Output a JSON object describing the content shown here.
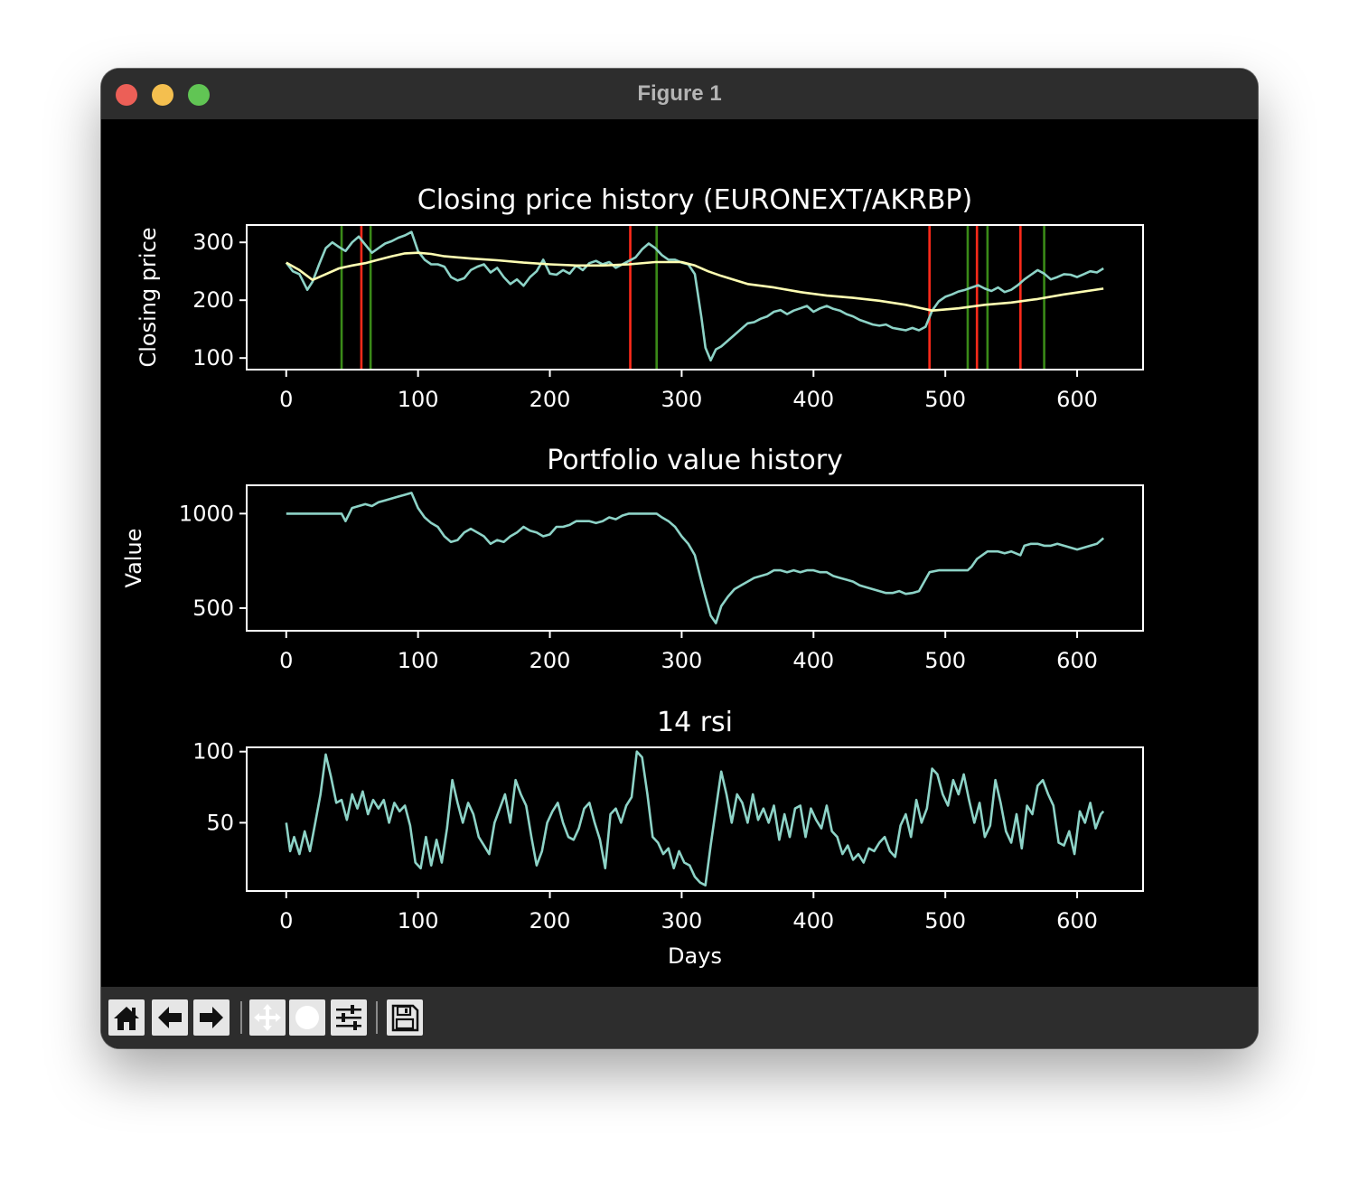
{
  "window": {
    "title": "Figure 1"
  },
  "toolbar": {
    "buttons": [
      {
        "name": "home",
        "icon": "home-icon"
      },
      {
        "name": "back",
        "icon": "arrow-left-icon"
      },
      {
        "name": "forward",
        "icon": "arrow-right-icon"
      },
      {
        "name": "pan",
        "icon": "move-icon"
      },
      {
        "name": "zoom",
        "icon": "zoom-icon"
      },
      {
        "name": "configure",
        "icon": "sliders-icon"
      },
      {
        "name": "save",
        "icon": "save-icon"
      }
    ]
  },
  "colors": {
    "figure_bg": "#000000",
    "axes_edge": "#ffffff",
    "text": "#ffffff",
    "series_main": "#8dd3c7",
    "series_ma": "#ffffb3",
    "buy_line": "#3a8a18",
    "sell_line": "#ff2a1a"
  },
  "chart_data": [
    {
      "type": "line",
      "title": "Closing price history (EURONEXT/AKRBP)",
      "xlabel": "",
      "ylabel": "Closing price",
      "xlim": [
        -30,
        650
      ],
      "ylim": [
        80,
        330
      ],
      "xticks": [
        0,
        100,
        200,
        300,
        400,
        500,
        600
      ],
      "yticks": [
        100,
        200,
        300
      ],
      "series": [
        {
          "role": "price",
          "color": "#8dd3c7",
          "x": [
            0,
            5,
            10,
            16,
            20,
            25,
            30,
            35,
            40,
            45,
            50,
            55,
            60,
            65,
            70,
            75,
            80,
            85,
            90,
            95,
            100,
            105,
            110,
            115,
            120,
            125,
            130,
            135,
            140,
            145,
            150,
            155,
            160,
            165,
            170,
            175,
            180,
            185,
            190,
            195,
            200,
            205,
            210,
            215,
            220,
            225,
            230,
            235,
            240,
            245,
            250,
            255,
            260,
            265,
            270,
            275,
            280,
            285,
            290,
            295,
            300,
            305,
            310,
            315,
            318,
            322,
            326,
            330,
            335,
            340,
            345,
            350,
            355,
            360,
            365,
            370,
            375,
            380,
            385,
            390,
            395,
            400,
            405,
            410,
            415,
            420,
            425,
            430,
            435,
            440,
            445,
            450,
            455,
            460,
            465,
            470,
            475,
            480,
            485,
            490,
            495,
            500,
            505,
            510,
            515,
            520,
            525,
            530,
            535,
            540,
            545,
            550,
            555,
            560,
            565,
            570,
            575,
            580,
            585,
            590,
            595,
            600,
            605,
            610,
            615,
            620
          ],
          "y": [
            265,
            250,
            245,
            218,
            232,
            262,
            290,
            300,
            292,
            285,
            300,
            310,
            296,
            282,
            290,
            298,
            302,
            308,
            312,
            318,
            285,
            270,
            262,
            262,
            258,
            240,
            234,
            238,
            252,
            258,
            262,
            248,
            256,
            240,
            228,
            236,
            225,
            240,
            250,
            270,
            246,
            244,
            252,
            246,
            260,
            252,
            264,
            268,
            262,
            266,
            256,
            262,
            268,
            274,
            288,
            298,
            290,
            278,
            270,
            270,
            265,
            262,
            245,
            170,
            118,
            96,
            115,
            120,
            130,
            140,
            150,
            160,
            162,
            168,
            172,
            180,
            183,
            176,
            182,
            186,
            190,
            180,
            186,
            190,
            185,
            182,
            176,
            172,
            166,
            162,
            158,
            156,
            158,
            152,
            150,
            148,
            152,
            148,
            154,
            182,
            198,
            206,
            210,
            215,
            218,
            222,
            226,
            220,
            216,
            222,
            214,
            218,
            226,
            236,
            244,
            252,
            246,
            236,
            240,
            245,
            244,
            240,
            245,
            250,
            248,
            255
          ]
        },
        {
          "role": "moving-average",
          "color": "#ffffb3",
          "x": [
            0,
            10,
            20,
            30,
            40,
            50,
            60,
            70,
            80,
            90,
            100,
            110,
            120,
            140,
            160,
            180,
            200,
            220,
            240,
            260,
            280,
            300,
            310,
            320,
            330,
            340,
            350,
            370,
            390,
            410,
            430,
            450,
            470,
            490,
            510,
            530,
            550,
            570,
            590,
            620
          ],
          "y": [
            265,
            252,
            235,
            245,
            255,
            260,
            264,
            270,
            276,
            281,
            282,
            280,
            276,
            272,
            269,
            265,
            262,
            260,
            260,
            262,
            266,
            266,
            260,
            250,
            242,
            235,
            228,
            222,
            214,
            208,
            204,
            199,
            192,
            182,
            186,
            192,
            196,
            202,
            210,
            220
          ]
        }
      ],
      "vlines": {
        "buy": {
          "color": "#3a8a18",
          "x": [
            42,
            64,
            281,
            517,
            532,
            575
          ]
        },
        "sell": {
          "color": "#ff2a1a",
          "x": [
            57,
            261,
            488,
            524,
            557
          ]
        }
      }
    },
    {
      "type": "line",
      "title": "Portfolio value history",
      "xlabel": "",
      "ylabel": "Value",
      "xlim": [
        -30,
        650
      ],
      "ylim": [
        380,
        1150
      ],
      "xticks": [
        0,
        100,
        200,
        300,
        400,
        500,
        600
      ],
      "yticks": [
        500,
        1000
      ],
      "series": [
        {
          "role": "portfolio",
          "color": "#8dd3c7",
          "x": [
            0,
            42,
            45,
            50,
            55,
            60,
            65,
            70,
            75,
            80,
            85,
            90,
            95,
            100,
            105,
            110,
            115,
            120,
            125,
            130,
            135,
            140,
            145,
            150,
            155,
            160,
            165,
            170,
            175,
            180,
            185,
            190,
            195,
            200,
            205,
            210,
            215,
            220,
            225,
            230,
            235,
            240,
            245,
            250,
            255,
            260,
            265,
            270,
            275,
            281,
            285,
            290,
            295,
            300,
            305,
            310,
            315,
            318,
            322,
            326,
            330,
            335,
            340,
            345,
            350,
            355,
            360,
            365,
            370,
            375,
            380,
            385,
            390,
            395,
            400,
            405,
            410,
            415,
            420,
            425,
            430,
            435,
            440,
            445,
            450,
            455,
            460,
            465,
            470,
            475,
            480,
            488,
            495,
            500,
            505,
            510,
            517,
            520,
            524,
            530,
            532,
            540,
            545,
            550,
            557,
            560,
            565,
            570,
            575,
            580,
            585,
            590,
            595,
            600,
            605,
            610,
            615,
            620
          ],
          "y": [
            1000,
            1000,
            960,
            1030,
            1040,
            1050,
            1040,
            1060,
            1070,
            1080,
            1090,
            1100,
            1110,
            1030,
            980,
            950,
            930,
            880,
            850,
            860,
            900,
            920,
            900,
            880,
            840,
            860,
            850,
            880,
            900,
            930,
            910,
            900,
            880,
            890,
            930,
            930,
            940,
            960,
            960,
            960,
            950,
            960,
            980,
            970,
            990,
            1000,
            1000,
            1000,
            1000,
            1000,
            980,
            960,
            930,
            880,
            840,
            780,
            640,
            560,
            460,
            420,
            510,
            560,
            600,
            620,
            640,
            660,
            670,
            680,
            700,
            700,
            690,
            700,
            690,
            700,
            700,
            690,
            690,
            670,
            660,
            650,
            640,
            620,
            610,
            600,
            590,
            580,
            580,
            590,
            575,
            580,
            590,
            690,
            700,
            700,
            700,
            700,
            700,
            720,
            760,
            790,
            800,
            800,
            790,
            800,
            780,
            830,
            840,
            840,
            830,
            830,
            840,
            830,
            820,
            810,
            820,
            830,
            840,
            870
          ]
        }
      ]
    },
    {
      "type": "line",
      "title": "14 rsi",
      "xlabel": "Days",
      "ylabel": "",
      "xlim": [
        -30,
        650
      ],
      "ylim": [
        2,
        103
      ],
      "xticks": [
        0,
        100,
        200,
        300,
        400,
        500,
        600
      ],
      "yticks": [
        50,
        100
      ],
      "series": [
        {
          "role": "rsi",
          "color": "#8dd3c7",
          "x": [
            0,
            3,
            6,
            10,
            14,
            18,
            22,
            26,
            30,
            34,
            38,
            42,
            46,
            50,
            54,
            58,
            62,
            66,
            70,
            74,
            78,
            82,
            86,
            90,
            94,
            98,
            102,
            106,
            110,
            114,
            118,
            122,
            126,
            130,
            134,
            138,
            142,
            146,
            150,
            154,
            158,
            162,
            166,
            170,
            174,
            178,
            182,
            186,
            190,
            194,
            198,
            202,
            206,
            210,
            214,
            218,
            222,
            226,
            230,
            234,
            238,
            242,
            246,
            250,
            254,
            258,
            262,
            266,
            270,
            274,
            278,
            282,
            286,
            290,
            294,
            298,
            302,
            306,
            310,
            314,
            318,
            322,
            326,
            330,
            334,
            338,
            342,
            346,
            350,
            354,
            358,
            362,
            366,
            370,
            374,
            378,
            382,
            386,
            390,
            394,
            398,
            402,
            406,
            410,
            414,
            418,
            422,
            426,
            430,
            434,
            438,
            442,
            446,
            450,
            454,
            458,
            462,
            466,
            470,
            474,
            478,
            482,
            486,
            490,
            494,
            498,
            502,
            506,
            510,
            514,
            518,
            522,
            526,
            530,
            534,
            538,
            542,
            546,
            550,
            554,
            558,
            562,
            566,
            570,
            574,
            578,
            582,
            586,
            590,
            594,
            598,
            602,
            606,
            610,
            614,
            618,
            620
          ],
          "y": [
            50,
            30,
            40,
            28,
            44,
            30,
            50,
            70,
            98,
            82,
            64,
            66,
            52,
            70,
            60,
            72,
            56,
            66,
            60,
            66,
            50,
            64,
            58,
            62,
            48,
            22,
            18,
            40,
            20,
            38,
            22,
            46,
            80,
            64,
            50,
            64,
            56,
            40,
            34,
            28,
            50,
            60,
            70,
            50,
            80,
            70,
            62,
            40,
            20,
            30,
            50,
            58,
            64,
            50,
            40,
            38,
            46,
            60,
            64,
            50,
            38,
            18,
            56,
            60,
            50,
            62,
            68,
            100,
            96,
            70,
            40,
            36,
            28,
            32,
            18,
            30,
            22,
            20,
            12,
            8,
            6,
            34,
            60,
            86,
            70,
            50,
            70,
            64,
            50,
            70,
            52,
            60,
            50,
            62,
            38,
            56,
            40,
            60,
            62,
            40,
            60,
            52,
            46,
            62,
            44,
            40,
            28,
            34,
            24,
            28,
            22,
            32,
            30,
            36,
            40,
            30,
            26,
            48,
            56,
            40,
            66,
            50,
            60,
            88,
            84,
            70,
            62,
            80,
            70,
            84,
            66,
            50,
            64,
            40,
            48,
            80,
            64,
            44,
            36,
            56,
            32,
            62,
            56,
            76,
            80,
            70,
            62,
            36,
            34,
            44,
            28,
            58,
            50,
            64,
            46,
            56,
            58
          ]
        }
      ]
    }
  ]
}
